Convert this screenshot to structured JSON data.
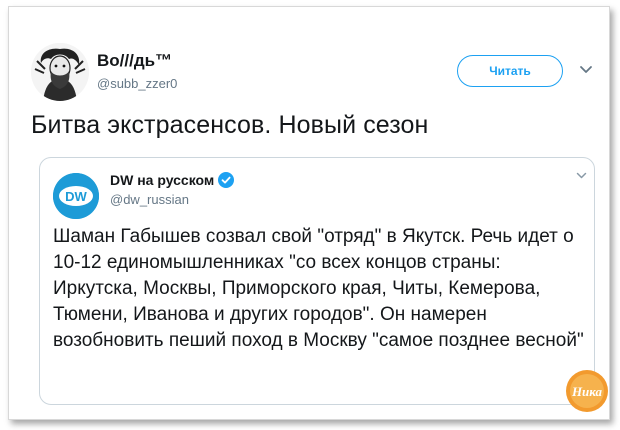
{
  "author": {
    "name": "Во///дь™",
    "handle": "@subb_zzer0",
    "avatar_icon": "portrait-avatar"
  },
  "actions": {
    "follow_label": "Читать",
    "menu_icon": "chevron-down-icon"
  },
  "tweet": {
    "text": "Битва экстрасенсов. Новый сезон"
  },
  "quoted": {
    "name": "DW на русском",
    "handle": "@dw_russian",
    "avatar_text": "DW",
    "verified_icon": "verified-badge-icon",
    "text": "Шаман Габышев созвал свой \"отряд\" в Якутск. Речь идет о 10-12 единомышленниках \"со всех концов страны: Иркутска, Москвы, Приморского края, Читы, Кемерова, Тюмени, Иванова и других городов\". Он намерен возобновить пеший поход в Москву \"самое позднее весной\""
  },
  "watermark": {
    "text": "Ника"
  },
  "colors": {
    "accent": "#1da1f2",
    "dw_blue": "#1d9bd7",
    "secondary_text": "#657786",
    "watermark_orange": "#f29a2e"
  }
}
